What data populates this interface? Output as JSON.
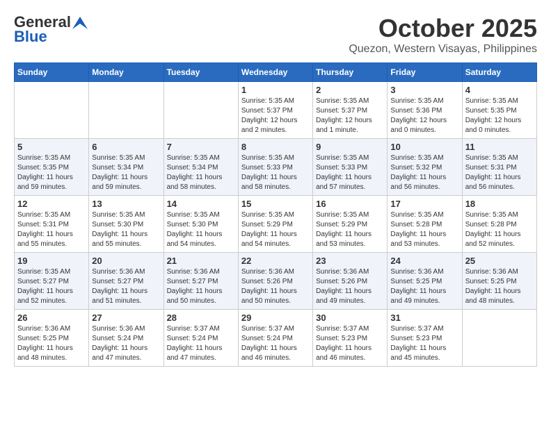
{
  "header": {
    "logo_general": "General",
    "logo_blue": "Blue",
    "month_title": "October 2025",
    "location": "Quezon, Western Visayas, Philippines"
  },
  "calendar": {
    "days_of_week": [
      "Sunday",
      "Monday",
      "Tuesday",
      "Wednesday",
      "Thursday",
      "Friday",
      "Saturday"
    ],
    "weeks": [
      [
        {
          "day": "",
          "info": ""
        },
        {
          "day": "",
          "info": ""
        },
        {
          "day": "",
          "info": ""
        },
        {
          "day": "1",
          "info": "Sunrise: 5:35 AM\nSunset: 5:37 PM\nDaylight: 12 hours\nand 2 minutes."
        },
        {
          "day": "2",
          "info": "Sunrise: 5:35 AM\nSunset: 5:37 PM\nDaylight: 12 hours\nand 1 minute."
        },
        {
          "day": "3",
          "info": "Sunrise: 5:35 AM\nSunset: 5:36 PM\nDaylight: 12 hours\nand 0 minutes."
        },
        {
          "day": "4",
          "info": "Sunrise: 5:35 AM\nSunset: 5:35 PM\nDaylight: 12 hours\nand 0 minutes."
        }
      ],
      [
        {
          "day": "5",
          "info": "Sunrise: 5:35 AM\nSunset: 5:35 PM\nDaylight: 11 hours\nand 59 minutes."
        },
        {
          "day": "6",
          "info": "Sunrise: 5:35 AM\nSunset: 5:34 PM\nDaylight: 11 hours\nand 59 minutes."
        },
        {
          "day": "7",
          "info": "Sunrise: 5:35 AM\nSunset: 5:34 PM\nDaylight: 11 hours\nand 58 minutes."
        },
        {
          "day": "8",
          "info": "Sunrise: 5:35 AM\nSunset: 5:33 PM\nDaylight: 11 hours\nand 58 minutes."
        },
        {
          "day": "9",
          "info": "Sunrise: 5:35 AM\nSunset: 5:33 PM\nDaylight: 11 hours\nand 57 minutes."
        },
        {
          "day": "10",
          "info": "Sunrise: 5:35 AM\nSunset: 5:32 PM\nDaylight: 11 hours\nand 56 minutes."
        },
        {
          "day": "11",
          "info": "Sunrise: 5:35 AM\nSunset: 5:31 PM\nDaylight: 11 hours\nand 56 minutes."
        }
      ],
      [
        {
          "day": "12",
          "info": "Sunrise: 5:35 AM\nSunset: 5:31 PM\nDaylight: 11 hours\nand 55 minutes."
        },
        {
          "day": "13",
          "info": "Sunrise: 5:35 AM\nSunset: 5:30 PM\nDaylight: 11 hours\nand 55 minutes."
        },
        {
          "day": "14",
          "info": "Sunrise: 5:35 AM\nSunset: 5:30 PM\nDaylight: 11 hours\nand 54 minutes."
        },
        {
          "day": "15",
          "info": "Sunrise: 5:35 AM\nSunset: 5:29 PM\nDaylight: 11 hours\nand 54 minutes."
        },
        {
          "day": "16",
          "info": "Sunrise: 5:35 AM\nSunset: 5:29 PM\nDaylight: 11 hours\nand 53 minutes."
        },
        {
          "day": "17",
          "info": "Sunrise: 5:35 AM\nSunset: 5:28 PM\nDaylight: 11 hours\nand 53 minutes."
        },
        {
          "day": "18",
          "info": "Sunrise: 5:35 AM\nSunset: 5:28 PM\nDaylight: 11 hours\nand 52 minutes."
        }
      ],
      [
        {
          "day": "19",
          "info": "Sunrise: 5:35 AM\nSunset: 5:27 PM\nDaylight: 11 hours\nand 52 minutes."
        },
        {
          "day": "20",
          "info": "Sunrise: 5:36 AM\nSunset: 5:27 PM\nDaylight: 11 hours\nand 51 minutes."
        },
        {
          "day": "21",
          "info": "Sunrise: 5:36 AM\nSunset: 5:27 PM\nDaylight: 11 hours\nand 50 minutes."
        },
        {
          "day": "22",
          "info": "Sunrise: 5:36 AM\nSunset: 5:26 PM\nDaylight: 11 hours\nand 50 minutes."
        },
        {
          "day": "23",
          "info": "Sunrise: 5:36 AM\nSunset: 5:26 PM\nDaylight: 11 hours\nand 49 minutes."
        },
        {
          "day": "24",
          "info": "Sunrise: 5:36 AM\nSunset: 5:25 PM\nDaylight: 11 hours\nand 49 minutes."
        },
        {
          "day": "25",
          "info": "Sunrise: 5:36 AM\nSunset: 5:25 PM\nDaylight: 11 hours\nand 48 minutes."
        }
      ],
      [
        {
          "day": "26",
          "info": "Sunrise: 5:36 AM\nSunset: 5:25 PM\nDaylight: 11 hours\nand 48 minutes."
        },
        {
          "day": "27",
          "info": "Sunrise: 5:36 AM\nSunset: 5:24 PM\nDaylight: 11 hours\nand 47 minutes."
        },
        {
          "day": "28",
          "info": "Sunrise: 5:37 AM\nSunset: 5:24 PM\nDaylight: 11 hours\nand 47 minutes."
        },
        {
          "day": "29",
          "info": "Sunrise: 5:37 AM\nSunset: 5:24 PM\nDaylight: 11 hours\nand 46 minutes."
        },
        {
          "day": "30",
          "info": "Sunrise: 5:37 AM\nSunset: 5:23 PM\nDaylight: 11 hours\nand 46 minutes."
        },
        {
          "day": "31",
          "info": "Sunrise: 5:37 AM\nSunset: 5:23 PM\nDaylight: 11 hours\nand 45 minutes."
        },
        {
          "day": "",
          "info": ""
        }
      ]
    ]
  }
}
